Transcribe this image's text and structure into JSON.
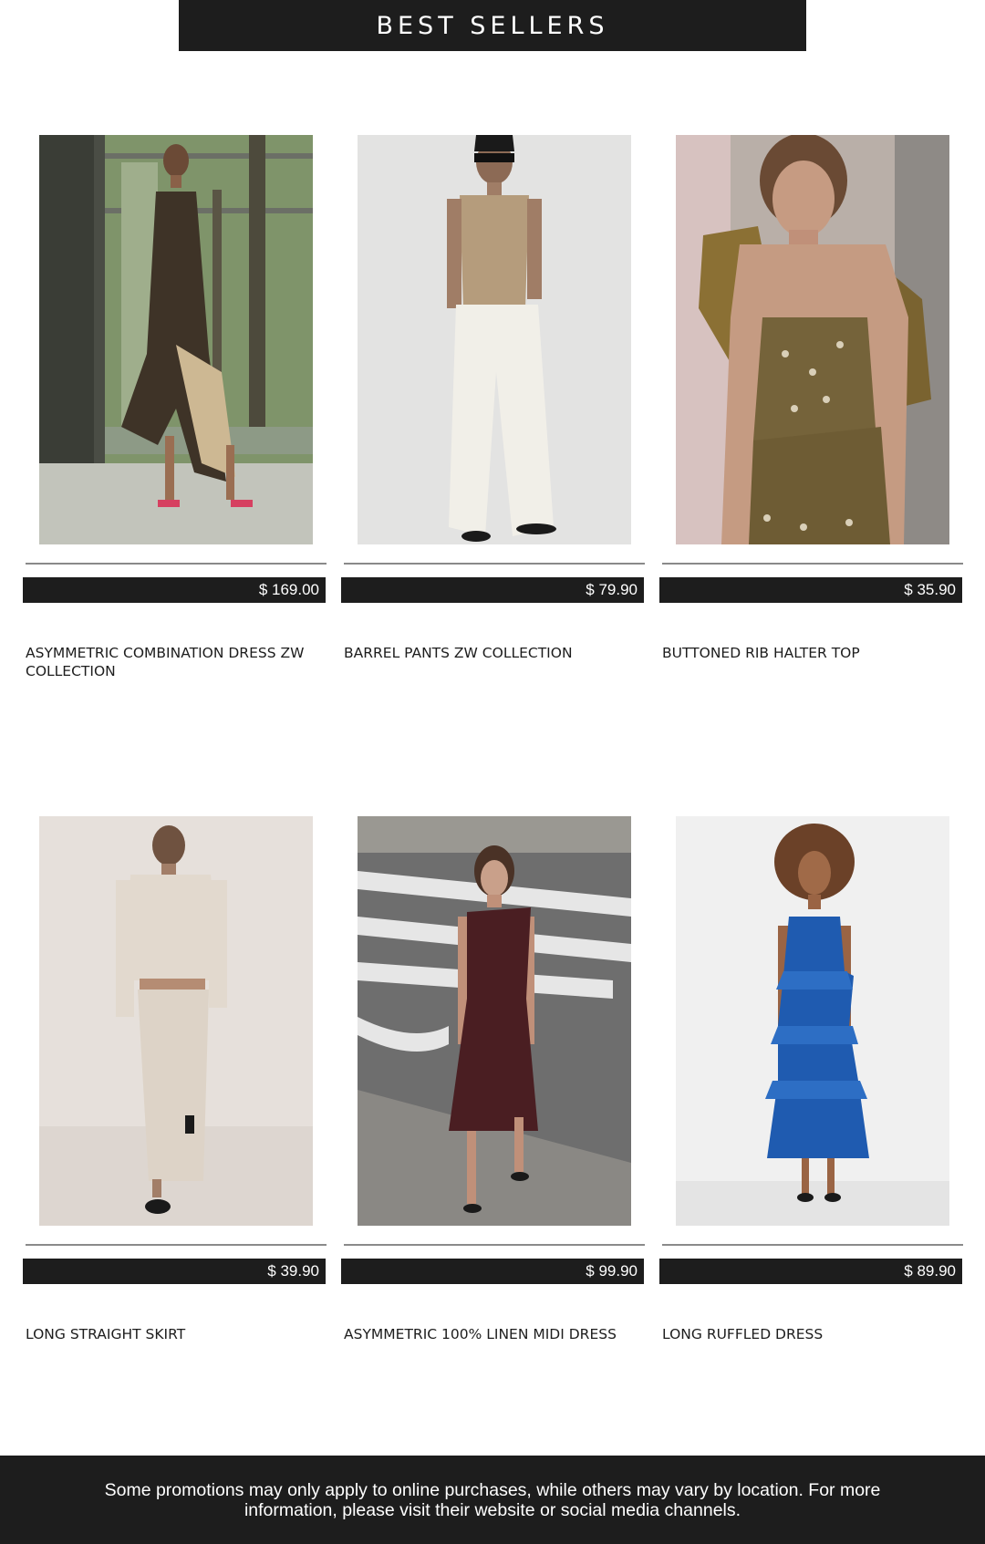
{
  "header": {
    "title": "BEST SELLERS"
  },
  "products": [
    {
      "name": "ASYMMETRIC COMBINATION DRESS ZW COLLECTION",
      "price": "$ 169.00",
      "image": "model-brown-sheer-halter-dress"
    },
    {
      "name": "BARREL PANTS ZW COLLECTION",
      "price": "$ 79.90",
      "image": "model-knit-top-white-barrel-pants"
    },
    {
      "name": "BUTTONED RIB HALTER TOP",
      "price": "$ 35.90",
      "image": "model-olive-buttoned-halter-top"
    },
    {
      "name": "LONG STRAIGHT SKIRT",
      "price": "$ 39.90",
      "image": "model-cream-cardigan-long-skirt"
    },
    {
      "name": "ASYMMETRIC 100% LINEN MIDI DRESS",
      "price": "$ 99.90",
      "image": "model-burgundy-linen-midi-dress"
    },
    {
      "name": "LONG RUFFLED DRESS",
      "price": "$ 89.90",
      "image": "model-blue-ruffled-halter-dress"
    }
  ],
  "footer": {
    "notice": "Some promotions may only apply to online purchases, while others may vary by location. For more information, please visit their website or social media channels."
  },
  "colors": {
    "bar": "#1d1d1d",
    "divider": "#8a8a8a",
    "background": "#ffffff"
  }
}
